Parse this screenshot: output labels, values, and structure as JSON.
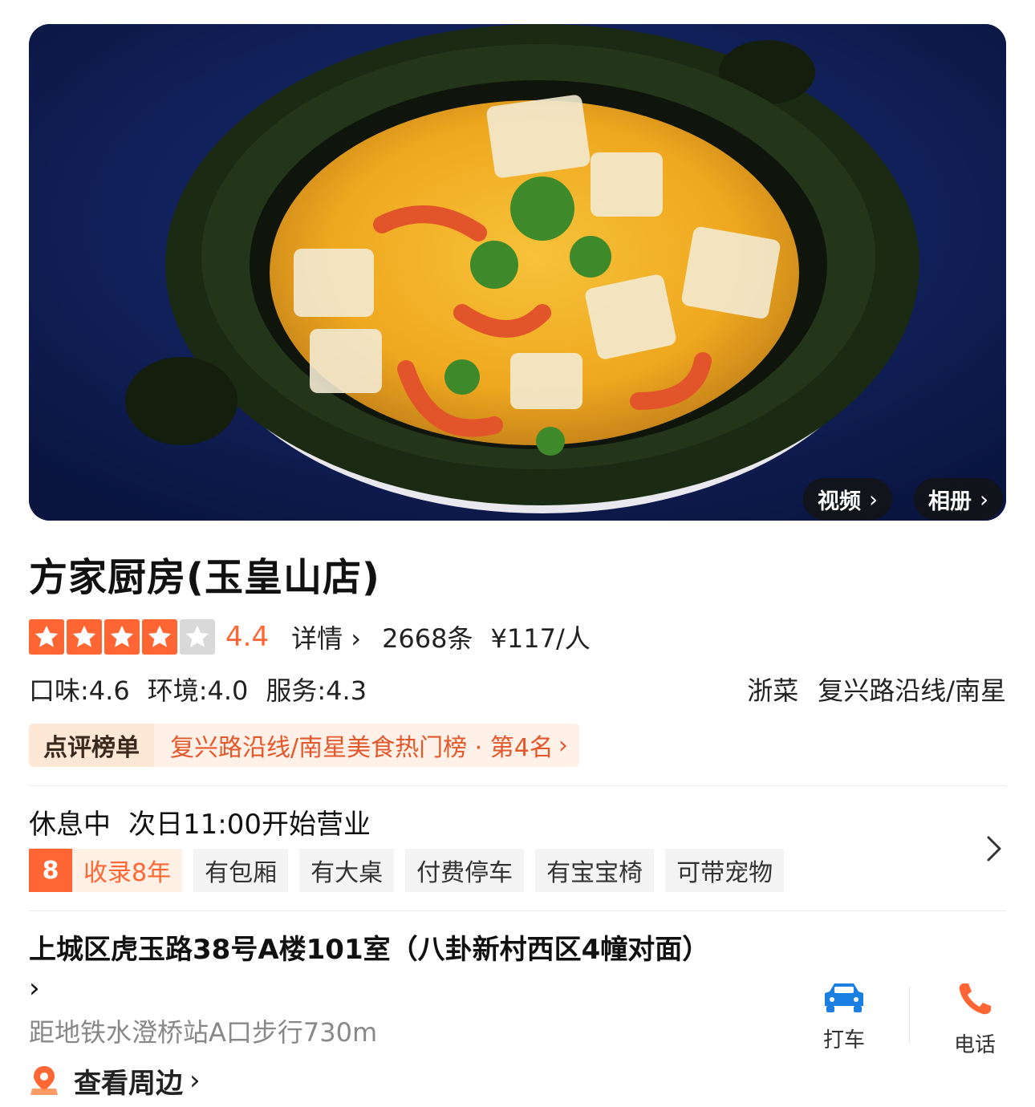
{
  "hero": {
    "video_label": "视频",
    "album_label": "相册"
  },
  "shop": {
    "name": "方家厨房(玉皇山店)",
    "rating": {
      "stars_filled": 4,
      "stars_total": 5,
      "score": "4.4",
      "detail_label": "详情",
      "review_count": "2668条",
      "price": "¥117/人"
    },
    "sub_scores": {
      "taste": "口味:4.6",
      "environment": "环境:4.0",
      "service": "服务:4.3"
    },
    "cuisine": "浙菜",
    "area": "复兴路沿线/南星"
  },
  "ranking": {
    "label": "点评榜单",
    "text": "复兴路沿线/南星美食热门榜 · 第4名"
  },
  "hours": {
    "state": "休息中",
    "next": "次日11:00开始营业"
  },
  "tags": {
    "years_badge": "8",
    "years_text": "收录8年",
    "items": [
      "有包厢",
      "有大桌",
      "付费停车",
      "有宝宝椅",
      "可带宠物"
    ]
  },
  "location": {
    "address": "上城区虎玉路38号A楼101室（八卦新村西区4幢对面）",
    "metro": "距地铁水澄桥站A口步行730m",
    "nearby_label": "查看周边"
  },
  "actions": {
    "taxi_label": "打车",
    "call_label": "电话"
  },
  "colors": {
    "accent": "#ff6633",
    "rank_text": "#e2582a",
    "taxi_icon": "#1a7fe0"
  }
}
